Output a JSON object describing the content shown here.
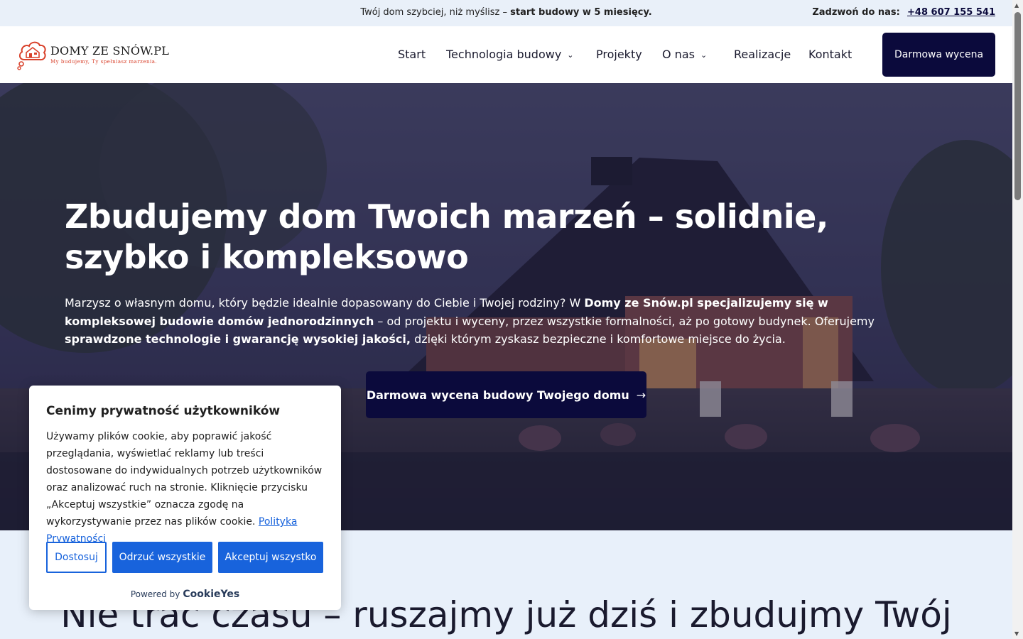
{
  "topbar": {
    "promo_prefix": "Twój dom szybciej, niż myślisz – ",
    "promo_bold": "start budowy w 5 miesięcy.",
    "phone_label": "Zadzwoń do nas:",
    "phone_number": "+48 607 155 541"
  },
  "header": {
    "logo_brand": "DOMY ZE SNÓW.PL",
    "logo_tagline": "My budujemy, Ty spełniasz marzenia.",
    "nav": [
      {
        "label": "Start",
        "has_dropdown": false
      },
      {
        "label": "Technologia budowy",
        "has_dropdown": true
      },
      {
        "label": "Projekty",
        "has_dropdown": false
      },
      {
        "label": "O nas",
        "has_dropdown": true
      },
      {
        "label": "Realizacje",
        "has_dropdown": false
      },
      {
        "label": "Kontakt",
        "has_dropdown": false
      }
    ],
    "cta_label": "Darmowa wycena",
    "chevron_icon": "chevron-down-icon"
  },
  "hero": {
    "title": "Zbudujemy dom Twoich marzeń – solidnie, szybko i kompleksowo",
    "text_1": "Marzysz o własnym domu, który będzie idealnie dopasowany do Ciebie i Twojej rodziny? W ",
    "text_2": "Domy ze Snów.pl specjalizujemy się w kompleksowej budowie domów jednorodzinnych",
    "text_3": " – od projektu i wyceny, przez wszystkie formalności, aż po gotowy budynek. Oferujemy ",
    "text_4": "sprawdzone technologie i gwarancję wysokiej jakości,",
    "text_5": " dzięki którym zyskasz bezpieczne i komfortowe miejsce do życia.",
    "cta_label": "Darmowa wycena budowy Twojego domu",
    "cta_arrow": "→"
  },
  "section2": {
    "heading": "Nie trać czasu – ruszajmy już dziś i zbudujmy Twój"
  },
  "cookie": {
    "title": "Cenimy prywatność użytkowników",
    "body": "Używamy plików cookie, aby poprawić jakość przeglądania, wyświetlać reklamy lub treści dostosowane do indywidualnych potrzeb użytkowników oraz analizować ruch na stronie. Kliknięcie przycisku „Akceptuj wszystkie” oznacza zgodę na wykorzystywanie przez nas plików cookie. ",
    "policy_link": "Polityka Prywatności",
    "btn_customize": "Dostosuj",
    "btn_reject": "Odrzuć wszystkie",
    "btn_accept": "Akceptuj wszystko",
    "powered_by": "Powered by",
    "powered_brand": "CookieYes"
  },
  "colors": {
    "navy": "#0b0a3c",
    "cookie_blue": "#1863dc",
    "logo_red": "#d9412b",
    "page_bg": "#e8f0fa"
  }
}
